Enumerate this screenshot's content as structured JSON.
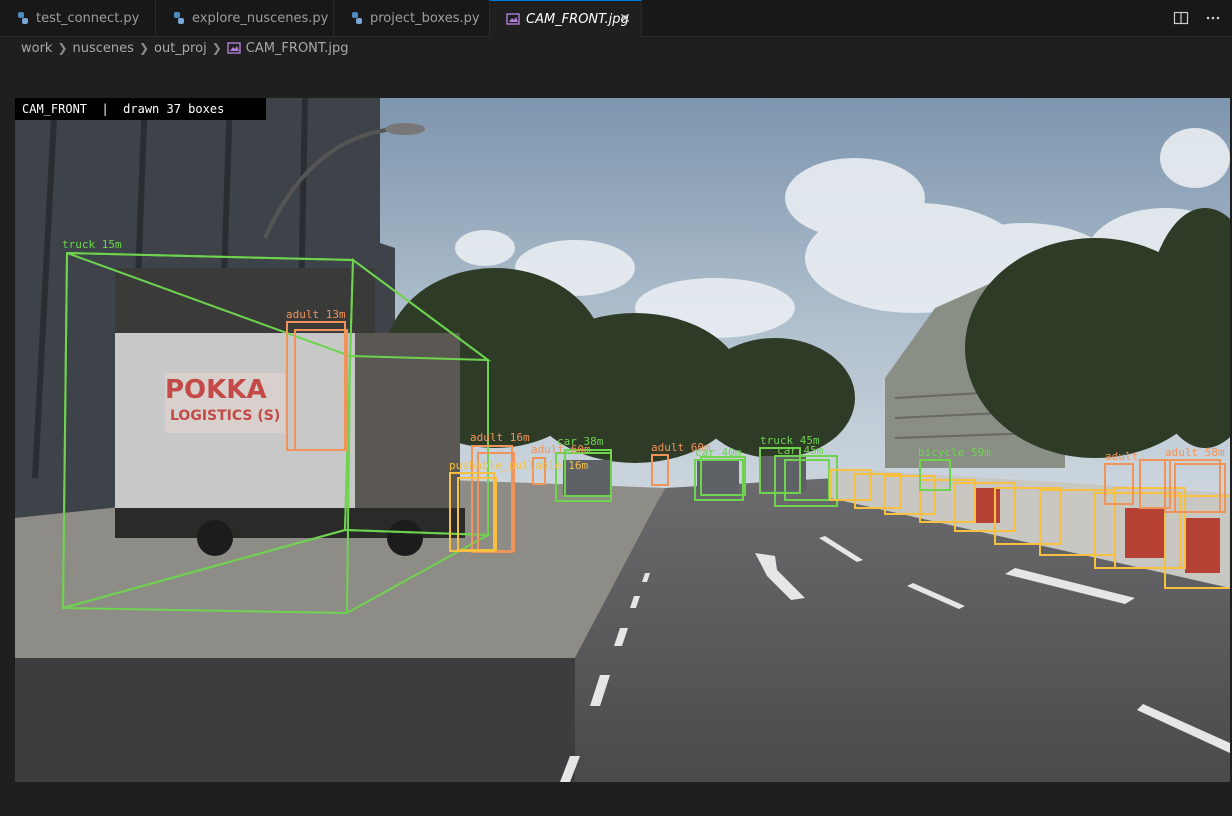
{
  "tabs": [
    {
      "label": "test_connect.py",
      "icon": "python-file-icon"
    },
    {
      "label": "explore_nuscenes.py",
      "icon": "python-file-icon"
    },
    {
      "label": "project_boxes.py",
      "icon": "python-file-icon"
    },
    {
      "label": "CAM_FRONT.jpg",
      "icon": "image-file-icon",
      "active": true
    }
  ],
  "breadcrumb": [
    "work",
    "nuscenes",
    "out_proj",
    "CAM_FRONT.jpg"
  ],
  "image": {
    "header_text": "CAM_FRONT  |  drawn 37 boxes",
    "labels": [
      "truck 15m",
      "adult 13m",
      "adult 16m",
      "pushable_pullable 16m",
      "car 38m",
      "adult 60m",
      "adult 60m",
      "car 40m",
      "truck 45m",
      "car 45m",
      "bicycle 59m",
      "adult",
      "adult 58m"
    ]
  },
  "colors": {
    "accent": "#0078d4",
    "vehicle_box": "#6fd34f",
    "pedestrian_box": "#f0945a",
    "barrier_box": "#f8c040"
  }
}
